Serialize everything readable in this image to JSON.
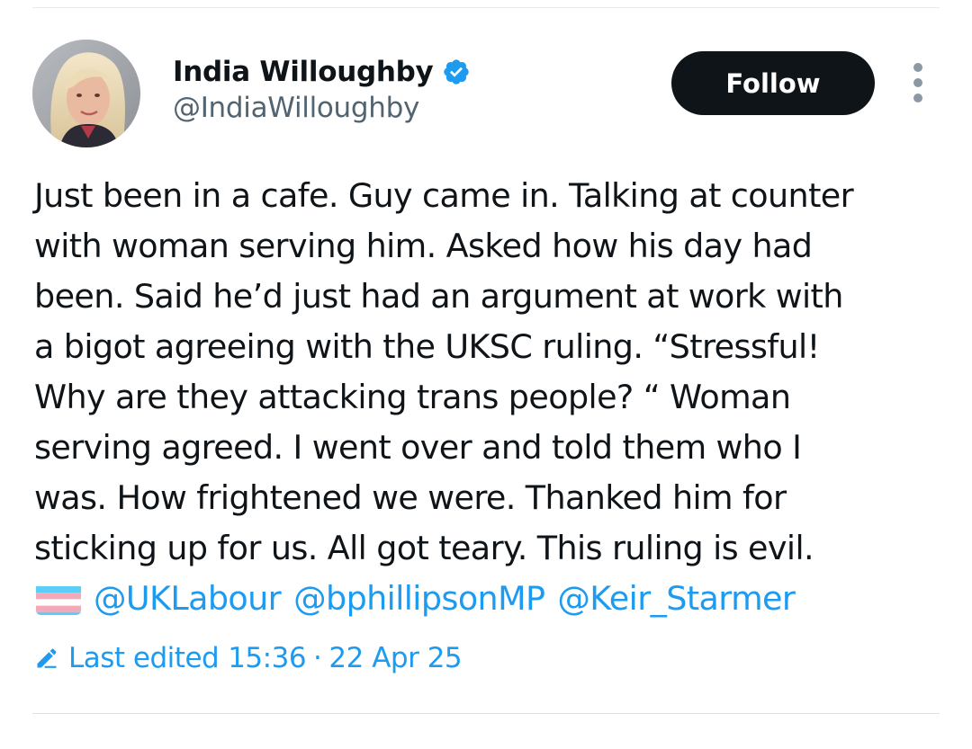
{
  "author": {
    "display_name": "India Willoughby",
    "handle": "@IndiaWilloughby",
    "verified_icon": "verified-badge-icon"
  },
  "actions": {
    "follow_label": "Follow",
    "more_icon": "more-vertical-icon"
  },
  "tweet": {
    "lines": [
      "Just been in a cafe. Guy came in. Talking at counter",
      "with woman serving him. Asked how his day had",
      "been. Said he’d just had an argument at work with",
      "a bigot agreeing with the UKSC ruling. “Stressful!",
      "Why are they attacking trans people? “ Woman",
      "serving agreed. I went over and told them who I",
      "was. How frightened we were. Thanked him for",
      "sticking up for us. All got teary. This ruling is evil."
    ],
    "emoji": "transgender-flag-icon",
    "mentions": [
      "@UKLabour",
      "@bphillipsonMP",
      "@Keir_Starmer"
    ]
  },
  "edited": {
    "icon": "pencil-icon",
    "label": "Last edited",
    "time": "15:36",
    "separator": "·",
    "date": "22 Apr 25"
  },
  "colors": {
    "accent": "#1d9bf0",
    "text": "#0f1419",
    "secondary": "#536471",
    "follow_bg": "#0f1419",
    "flag_blue": "#5BCEFA",
    "flag_pink": "#F5A9B8",
    "flag_white": "#FFFFFF"
  }
}
